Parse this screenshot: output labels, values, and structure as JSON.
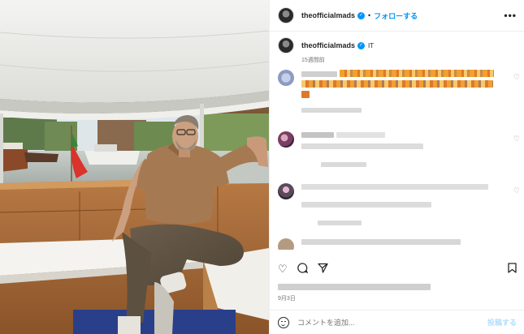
{
  "header": {
    "username": "theofficialmads",
    "verified_mark": "✓",
    "separator": "•",
    "follow_label": "フォローする",
    "more_icon": "•••"
  },
  "caption": {
    "username": "theofficialmads",
    "text": "IT",
    "time": "15週間前"
  },
  "comments": [
    {
      "avatar_color": "#a9b6d8",
      "has_heart": true,
      "kind": "emoji"
    },
    {
      "avatar_color": "#7a3f62",
      "has_heart": true,
      "kind": "text"
    },
    {
      "avatar_color": "#5b4a5e",
      "has_heart": true,
      "kind": "text"
    },
    {
      "avatar_color": "#b59a82",
      "has_heart": false,
      "kind": "text"
    }
  ],
  "actions": {
    "like_icon": "heart-icon",
    "comment_icon": "comment-icon",
    "share_icon": "share-icon",
    "save_icon": "bookmark-icon"
  },
  "post": {
    "date": "9月3日"
  },
  "add_comment": {
    "placeholder": "コメントを追加...",
    "post_label": "投稿する"
  },
  "colors": {
    "link_blue": "#0095f6",
    "post_disabled": "#b3dbff",
    "secondary_text": "#737373"
  }
}
